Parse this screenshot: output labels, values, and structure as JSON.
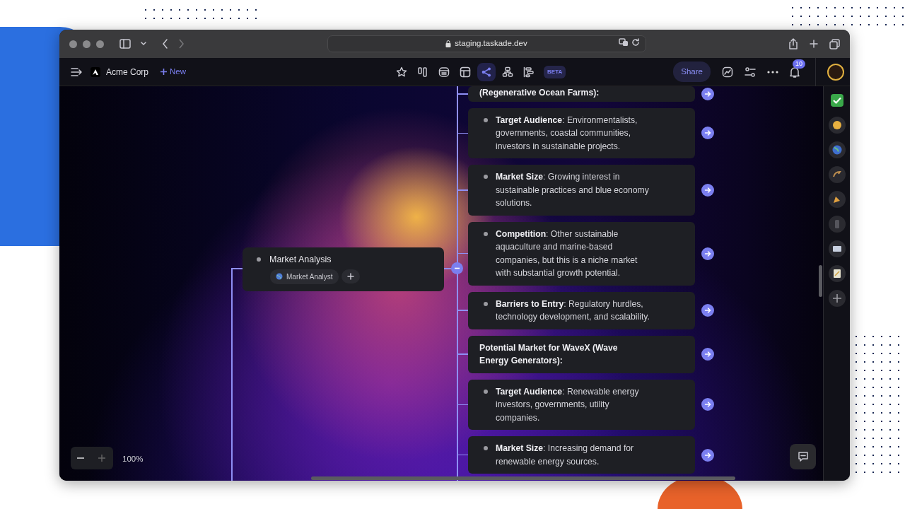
{
  "browser": {
    "address": "staging.taskade.dev"
  },
  "toolbar": {
    "workspace": "Acme Corp",
    "new_label": "New",
    "views": [
      {
        "selected": false
      },
      {
        "selected": false
      },
      {
        "selected": false
      },
      {
        "selected": false
      },
      {
        "selected": true
      },
      {
        "selected": false
      },
      {
        "selected": false
      }
    ],
    "beta_badge": "BETA",
    "share_label": "Share",
    "notification_count": "10"
  },
  "canvas": {
    "root": {
      "title": "Market Analysis",
      "agent": "Market Analyst",
      "expanded": true
    },
    "items": [
      {
        "kind": "heading",
        "text": "**(Regenerative Ocean Farms):**"
      },
      {
        "kind": "bullet",
        "text": "**Target Audience**: Environmentalists, governments, coastal communities, investors in sustainable projects."
      },
      {
        "kind": "bullet",
        "text": "**Market Size**: Growing interest in sustainable practices and blue economy solutions."
      },
      {
        "kind": "bullet",
        "text": "**Competition**: Other sustainable aquaculture and marine-based companies, but this is a niche market with substantial growth potential."
      },
      {
        "kind": "bullet",
        "text": "**Barriers to Entry**: Regulatory hurdles, technology development, and scalability."
      },
      {
        "kind": "heading",
        "text": "**Potential Market for WaveX (Wave Energy Generators):**"
      },
      {
        "kind": "bullet",
        "text": "**Target Audience**: Renewable energy investors, governments, utility companies."
      },
      {
        "kind": "bullet",
        "text": "**Market Size**: Increasing demand for renewable energy sources."
      }
    ],
    "zoom": "100%"
  }
}
